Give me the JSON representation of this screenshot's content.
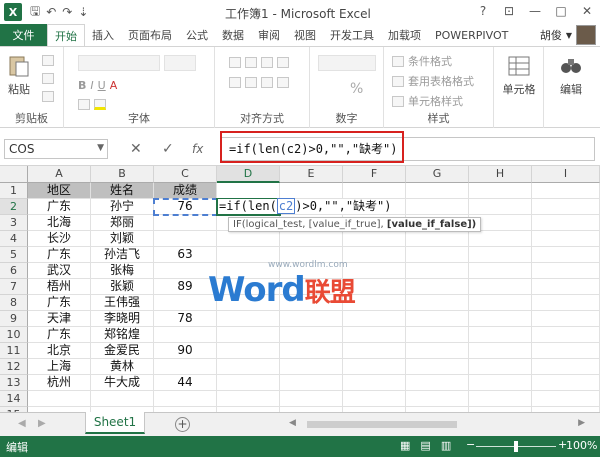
{
  "titlebar": {
    "app_logo": "X",
    "title": "工作簿1 - Microsoft Excel",
    "help": "?",
    "minimize": "—",
    "restore": "□",
    "close": "✕"
  },
  "tabs": {
    "file": "文件",
    "items": [
      "开始",
      "插入",
      "页面布局",
      "公式",
      "数据",
      "审阅",
      "视图",
      "开发工具",
      "加载项",
      "POWERPIVOT"
    ],
    "user": "胡俊"
  },
  "ribbon": {
    "clipboard": {
      "paste": "粘贴",
      "label": "剪贴板"
    },
    "font": {
      "label": "字体"
    },
    "alignment": {
      "label": "对齐方式"
    },
    "number": {
      "percent": "%",
      "label": "数字"
    },
    "styles": {
      "conditional": "条件格式",
      "table_format": "套用表格格式",
      "cell_styles": "单元格样式",
      "label": "样式"
    },
    "cells": {
      "label": "单元格"
    },
    "editing": {
      "label": "编辑"
    }
  },
  "formula_bar": {
    "name_box": "COS",
    "cancel": "✕",
    "enter": "✓",
    "fx": "fx",
    "formula": "=if(len(c2)>0,\"\",\"缺考\")"
  },
  "grid": {
    "columns": [
      "A",
      "B",
      "C",
      "D",
      "E",
      "F",
      "G",
      "H",
      "I"
    ],
    "rows": [
      "1",
      "2",
      "3",
      "4",
      "5",
      "6",
      "7",
      "8",
      "9",
      "10",
      "11",
      "12",
      "13",
      "14",
      "15"
    ],
    "headers": {
      "a": "地区",
      "b": "姓名",
      "c": "成绩"
    },
    "data": [
      {
        "a": "广东",
        "b": "孙宁",
        "c": "76"
      },
      {
        "a": "北海",
        "b": "郑丽",
        "c": ""
      },
      {
        "a": "长沙",
        "b": "刘颖",
        "c": ""
      },
      {
        "a": "广东",
        "b": "孙洁飞",
        "c": "63"
      },
      {
        "a": "武汉",
        "b": "张梅",
        "c": ""
      },
      {
        "a": "梧州",
        "b": "张颖",
        "c": "89"
      },
      {
        "a": "广东",
        "b": "王伟强",
        "c": ""
      },
      {
        "a": "天津",
        "b": "李晓明",
        "c": "78"
      },
      {
        "a": "广东",
        "b": "郑铭煌",
        "c": ""
      },
      {
        "a": "北京",
        "b": "金爱民",
        "c": "90"
      },
      {
        "a": "上海",
        "b": "黄林",
        "c": ""
      },
      {
        "a": "杭州",
        "b": "牛大成",
        "c": "44"
      }
    ],
    "edit": {
      "before": "=if(len(",
      "ref": "c2",
      "after": ")>0,\"\",\"缺考\")"
    },
    "tooltip": {
      "text": "IF(logical_test, [value_if_true], ",
      "bold": "[value_if_false])"
    },
    "watermark": {
      "url": "www.wordlm.com",
      "word": "Word",
      "suffix": "联盟"
    }
  },
  "sheets": {
    "active": "Sheet1",
    "add": "+"
  },
  "status": {
    "mode": "编辑",
    "zoom": "100%"
  },
  "colors": {
    "excel_green": "#217346",
    "highlight_red": "#d7211e",
    "ref_blue": "#4e7fd1"
  }
}
